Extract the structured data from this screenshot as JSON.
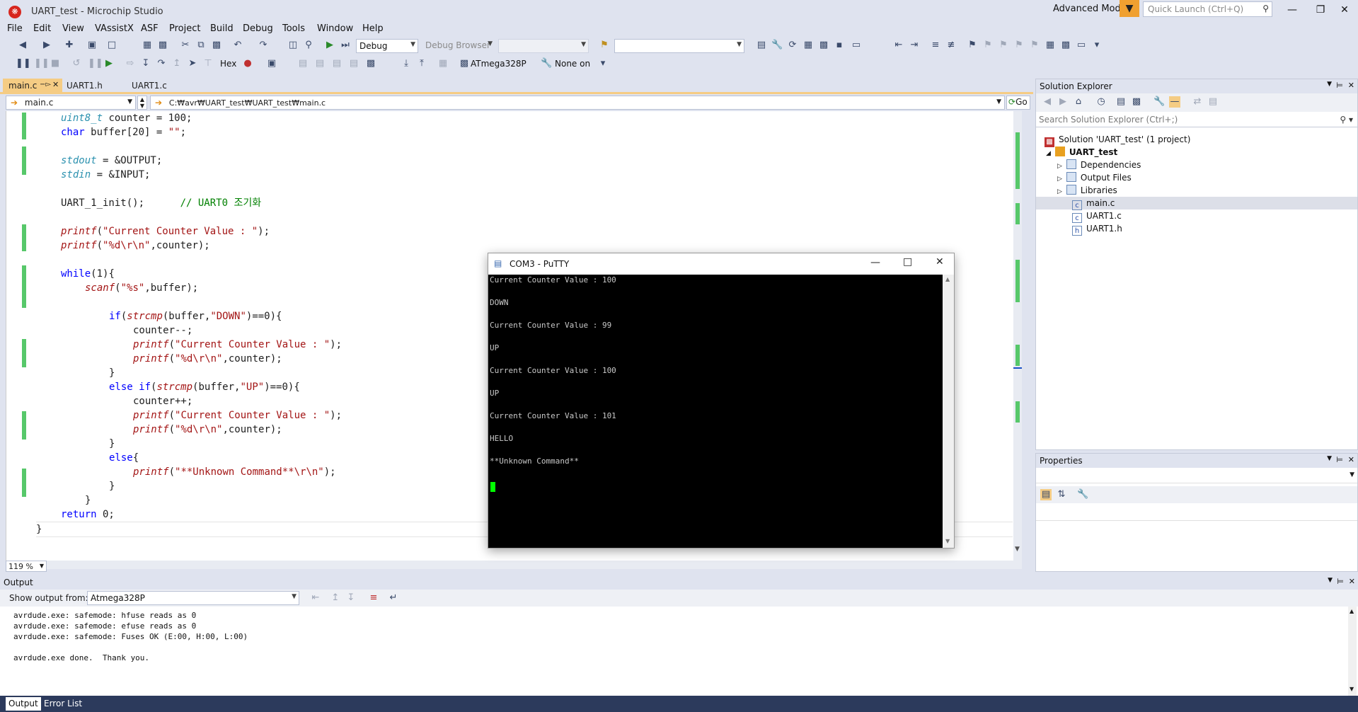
{
  "window": {
    "title": "UART_test - Microchip Studio",
    "advanced_mode": "Advanced Mode",
    "quick_launch_placeholder": "Quick Launch (Ctrl+Q)"
  },
  "menu": [
    "File",
    "Edit",
    "View",
    "VAssistX",
    "ASF",
    "Project",
    "Build",
    "Debug",
    "Tools",
    "Window",
    "Help"
  ],
  "toolbar": {
    "config": "Debug",
    "debug_browser": "Debug Browser",
    "hex_label": "Hex",
    "device": "ATmega328P",
    "tool": "None on"
  },
  "editor": {
    "tabs": [
      {
        "label": "main.c",
        "active": true
      },
      {
        "label": "UART1.h",
        "active": false
      },
      {
        "label": "UART1.c",
        "active": false
      }
    ],
    "nav_file": "main.c",
    "nav_path": "C:₩avr₩UART_test₩UART_test₩main.c",
    "go_label": "Go",
    "zoom": "119 %"
  },
  "code": {
    "l1a": "uint8_t",
    "l1b": " counter = 100;",
    "l2a": "char",
    "l2b": " buffer[20] = ",
    "l2c": "\"\"",
    "l2d": ";",
    "l3a": "stdout",
    "l3b": " = &OUTPUT;",
    "l4a": "stdin",
    "l4b": " = &INPUT;",
    "l5a": "UART_1_init();",
    "l5b": "      // UART0 조기화",
    "l6a": "printf",
    "l6b": "(",
    "l6c": "\"Current Counter Value : \"",
    "l6d": ");",
    "l7a": "printf",
    "l7b": "(",
    "l7c": "\"%d\\r\\n\"",
    "l7d": ",counter);",
    "l8a": "while",
    "l8b": "(1){",
    "l9a": "scanf",
    "l9b": "(",
    "l9c": "\"%s\"",
    "l9d": ",buffer);",
    "l10a": "if",
    "l10b": "(",
    "l10c": "strcmp",
    "l10d": "(buffer,",
    "l10e": "\"DOWN\"",
    "l10f": ")==0){",
    "l11": "counter--;",
    "l12a": "printf",
    "l12b": "(",
    "l12c": "\"Current Counter Value : \"",
    "l12d": ");",
    "l13a": "printf",
    "l13b": "(",
    "l13c": "\"%d\\r\\n\"",
    "l13d": ",counter);",
    "l14": "}",
    "l15a": "else if",
    "l15b": "(",
    "l15c": "strcmp",
    "l15d": "(buffer,",
    "l15e": "\"UP\"",
    "l15f": ")==0){",
    "l16": "counter++;",
    "l17a": "printf",
    "l17b": "(",
    "l17c": "\"Current Counter Value : \"",
    "l17d": ");",
    "l18a": "printf",
    "l18b": "(",
    "l18c": "\"%d\\r\\n\"",
    "l18d": ",counter);",
    "l19": "}",
    "l20a": "else",
    "l20b": "{",
    "l21a": "printf",
    "l21b": "(",
    "l21c": "\"**Unknown Command**\\r\\n\"",
    "l21d": ");",
    "l22": "}",
    "l23": "}",
    "l24a": "return",
    "l24b": " 0;",
    "l25": "}"
  },
  "solution_explorer": {
    "title": "Solution Explorer",
    "search_placeholder": "Search Solution Explorer (Ctrl+;)",
    "solution": "Solution 'UART_test' (1 project)",
    "project": "UART_test",
    "items": [
      "Dependencies",
      "Output Files",
      "Libraries",
      "main.c",
      "UART1.c",
      "UART1.h"
    ]
  },
  "properties": {
    "title": "Properties"
  },
  "output": {
    "title": "Output",
    "show_from_label": "Show output from:",
    "source": "Atmega328P",
    "lines": [
      "avrdude.exe: safemode: hfuse reads as 0",
      "avrdude.exe: safemode: efuse reads as 0",
      "avrdude.exe: safemode: Fuses OK (E:00, H:00, L:00)",
      "",
      "avrdude.exe done.  Thank you."
    ],
    "tabs": [
      "Output",
      "Error List"
    ]
  },
  "putty": {
    "title": "COM3 - PuTTY",
    "lines": [
      "Current Counter Value : 100",
      "",
      "DOWN",
      "",
      "Current Counter Value : 99",
      "",
      "UP",
      "",
      "Current Counter Value : 100",
      "",
      "UP",
      "",
      "Current Counter Value : 101",
      "",
      "HELLO",
      "",
      "**Unknown Command**"
    ]
  },
  "colors": {
    "chrome": "#dfe3ef",
    "active_tab": "#f5cc84",
    "change_bar": "#57c86a",
    "terminal_bg": "#000000",
    "cursor": "#00ff00"
  }
}
